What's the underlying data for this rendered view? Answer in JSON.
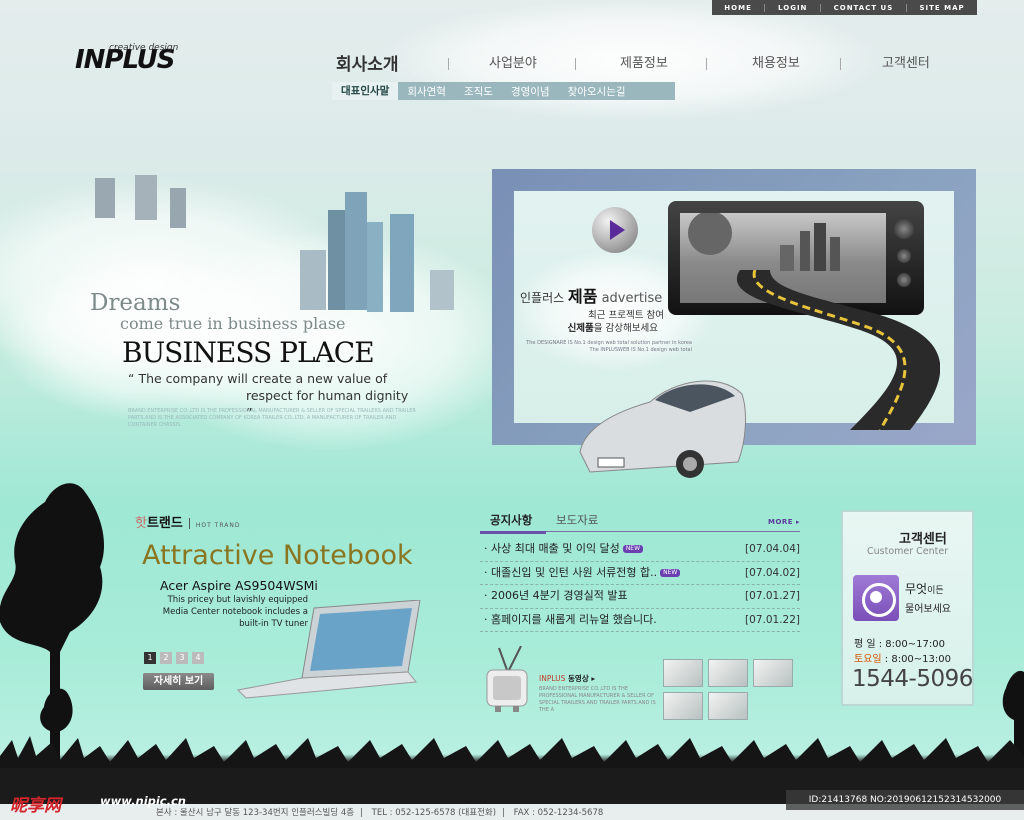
{
  "util_nav": [
    "HOME",
    "LOGIN",
    "CONTACT US",
    "SITE MAP"
  ],
  "logo": {
    "small": "creative design",
    "big": "INPLUS"
  },
  "main_nav": [
    "회사소개",
    "사업분야",
    "제품정보",
    "채용정보",
    "고객센터"
  ],
  "sub_nav": [
    "대표인사말",
    "회사연혁",
    "조직도",
    "경영이념",
    "찾아오시는길"
  ],
  "hero": {
    "dreams": "Dreams",
    "come": "come true in  business plase",
    "headline": "BUSINESS PLACE",
    "quote1": "“ The company will create a new value of",
    "quote2": "respect for human dignity ”",
    "fine": "BRAND ENTERPRISE CO.,LTD IS THE PROFESSIONAL MANUFACTURER & SELLER OF SPECIAL TRAILERS AND TRAILER PARTS.AND IS THE ASSOCIATED COMPANY OF KOREA TRAILER CO.,LTD. A MANUFACTURER OF TRAILER AND CONTAINER CHASSIS."
  },
  "product": {
    "prefix": "인플러스 ",
    "bold": "제품",
    "suffix": " advertise",
    "line1": "최근 프로젝트 참여",
    "line2_bold": "신제품",
    "line2_rest": "을 감상해보세요",
    "fine": "The DESIGNARE IS No.1 design web total solution partner in korea The INPLUSWEB IS No.1 design web total"
  },
  "hot_trend": {
    "prefix": "핫",
    "title": "트랜드",
    "eng": "HOT TRAND",
    "headline": "Attractive Notebook",
    "model": "Acer Aspire AS9504WSMi",
    "desc": "This pricey but lavishly equipped Media Center notebook includes a built-in TV tuner",
    "pages": [
      "1",
      "2",
      "3",
      "4"
    ],
    "detail_btn": "자세히 보기"
  },
  "notice": {
    "tab_active": "공지사항",
    "tab_other": "보도자료",
    "more": "MORE ▸",
    "new_badge": "NEW",
    "items": [
      {
        "title": "사상 최대 매출 및 이익 달성",
        "date": "[07.04.04]"
      },
      {
        "title": "대졸신입 및 인턴 사원 서류전형 합..",
        "date": "[07.04.02]"
      },
      {
        "title": "2006년 4분기 경영실적 발표",
        "date": "[07.01.27]"
      },
      {
        "title": "홈페이지를 새롭게 리뉴얼 했습니다.",
        "date": "[07.01.22]"
      }
    ]
  },
  "video": {
    "brand": "INPLUS",
    "label": " 동영상 ▸",
    "fine": "BRAND ENTERPRISE CO.,LTD IS THE PROFESSIONAL MANUFACTURER & SELLER OF SPECIAL TRAILERS AND TRAILER PARTS.AND IS THE A"
  },
  "customer": {
    "title": "고객센터",
    "sub": "Customer Center",
    "q1": "무엇",
    "q1_small": "이든",
    "q2": "물어보세요",
    "hours_weekday": "평  일 : 8:00~17:00",
    "hours_sat_label": "토요일",
    "hours_sat": " : 8:00~13:00",
    "tel": "1544-5096"
  },
  "footer": {
    "address": "본사 : 울산시 남구 달동 123-34번지 인플러스빌딩 4층",
    "tel": "TEL : 052-125-6578 (대표전화)",
    "fax": "FAX : 052-1234-5678"
  },
  "watermark": {
    "site": "昵享网",
    "url": "www.nipic.cn",
    "id": "ID:21413768 NO:20190612152314532000"
  }
}
